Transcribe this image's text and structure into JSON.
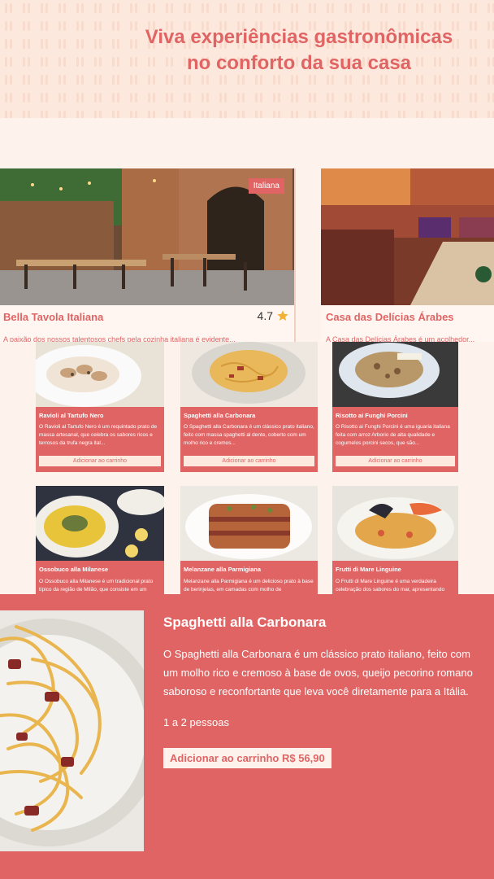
{
  "hero": {
    "title_line1": "Viva experiências gastronômicas",
    "title_line2": "no conforto da sua casa"
  },
  "restaurants": [
    {
      "name": "Bella Tavola Italiana",
      "tag": "Italiana",
      "rating": "4.7",
      "description": "A paixão dos nossos talentosos chefs pela cozinha italiana é evidente..."
    },
    {
      "name": "Casa das Delícias Árabes",
      "tag": "",
      "rating": "",
      "description": "A Casa das Delícias Árabes é um acolhedor..."
    }
  ],
  "dishes": [
    {
      "name": "Ravioli al Tartufo Nero",
      "desc": "O Ravioli al Tartufo Nero é um requintado prato de massa artesanal, que celebra os sabores ricos e terrosos da trufa negra ital...",
      "button": "Adicionar ao carrinho"
    },
    {
      "name": "Spaghetti alla Carbonara",
      "desc": "O Spaghetti alla Carbonara é um clássico prato italiano, feito com massa spaghetti al dente, coberto com um molho rico e cremos...",
      "button": "Adicionar ao carrinho"
    },
    {
      "name": "Risotto ai Funghi Porcini",
      "desc": "O Risotto ai Funghi Porcini é uma iguaria italiana feita com arroz Arborio de alta qualidade e cogumelos porcini secos, que são...",
      "button": "Adicionar ao carrinho"
    },
    {
      "name": "Ossobuco alla Milanese",
      "desc": "O Ossobuco alla Milanese é um tradicional prato típico da região de Milão, que consiste em um",
      "button": "Adicionar ao carrinho"
    },
    {
      "name": "Melanzane alla Parmigiana",
      "desc": "Melanzane alla Parmigiana é um delicioso prato à base de berinjelas, em camadas com molho de",
      "button": "Adicionar ao carrinho"
    },
    {
      "name": "Frutti di Mare Linguine",
      "desc": "O Frutti di Mare Linguine é uma verdadeira celebração dos sabores do mar, apresentando",
      "button": "Adicionar ao carrinho"
    }
  ],
  "detail": {
    "title": "Spaghetti alla Carbonara",
    "desc_line1": "O Spaghetti alla Carbonara é um clássico prato italiano, feito com",
    "desc_line2": "um molho rico e cremoso à base de ovos, queijo pecorino romano",
    "desc_line3": "saboroso e reconfortante que leva você diretamente para a Itália.",
    "serves": "1 a 2 pessoas",
    "button": "Adicionar ao carrinho R$ 56,90"
  },
  "colors": {
    "accent": "#e06464",
    "background": "#fdf3ec",
    "hero_bg": "#fce8dc",
    "star": "#f2b134"
  },
  "icons": {
    "rating": "star-icon"
  }
}
